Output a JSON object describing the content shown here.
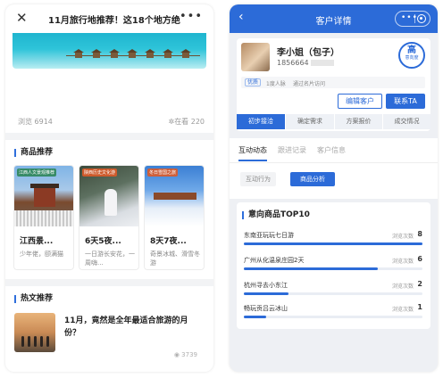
{
  "left": {
    "nav": {
      "close_icon": "close-icon",
      "title": "11月旅行地推荐！这18个地方绝",
      "more_icon": "more-icon"
    },
    "article": {
      "views": "浏览 6914",
      "watching": "在看 220"
    },
    "products": {
      "heading": "商品推荐",
      "items": [
        {
          "tag": "江西人文景观推荐",
          "name": "江西景...",
          "desc": "少年佬，颐满猫"
        },
        {
          "tag": "陕西历史文化游",
          "name": "6天5夜...",
          "desc": "一日游长安花，一周嗨..."
        },
        {
          "tag": "冬日雪国之旅",
          "name": "8天7夜...",
          "desc": "奇景冰城、滑雪冬游"
        }
      ]
    },
    "hot": {
      "heading": "热文推荐",
      "title": "11月，竟然是全年最适合旅游的月份？",
      "views": "3739"
    }
  },
  "right": {
    "nav": {
      "title": "客户详情",
      "back_icon": "back-icon"
    },
    "profile": {
      "name": "李小姐（包子）",
      "phone": "1856664",
      "level": "高",
      "level_sub": "意向度",
      "tag": "优质",
      "info1": "1度人脉",
      "info2": "通过名片访问",
      "edit_label": "编辑客户",
      "contact_label": "联系TA",
      "stages": [
        "初步接洽",
        "确定需求",
        "方案报价",
        "成交情况"
      ],
      "active_stage": 0
    },
    "tabs": [
      "互动动态",
      "跟进记录",
      "客户信息"
    ],
    "sub_tabs": [
      "互动行为",
      "商品分析"
    ],
    "top10": {
      "heading": "意向商品TOP10",
      "count_label": "浏览次数",
      "items": [
        {
          "name": "东南亚玩玩七日游",
          "count": "8",
          "ratio": 1.0
        },
        {
          "name": "广州从化温泉庄园2天",
          "count": "6",
          "ratio": 0.75
        },
        {
          "name": "杭州寻去小东江",
          "count": "2",
          "ratio": 0.25
        },
        {
          "name": "畅玩贡吕云冰山",
          "count": "1",
          "ratio": 0.125
        }
      ]
    },
    "colors": {
      "primary": "#2c6bd8",
      "bg": "#eef0f4"
    }
  }
}
